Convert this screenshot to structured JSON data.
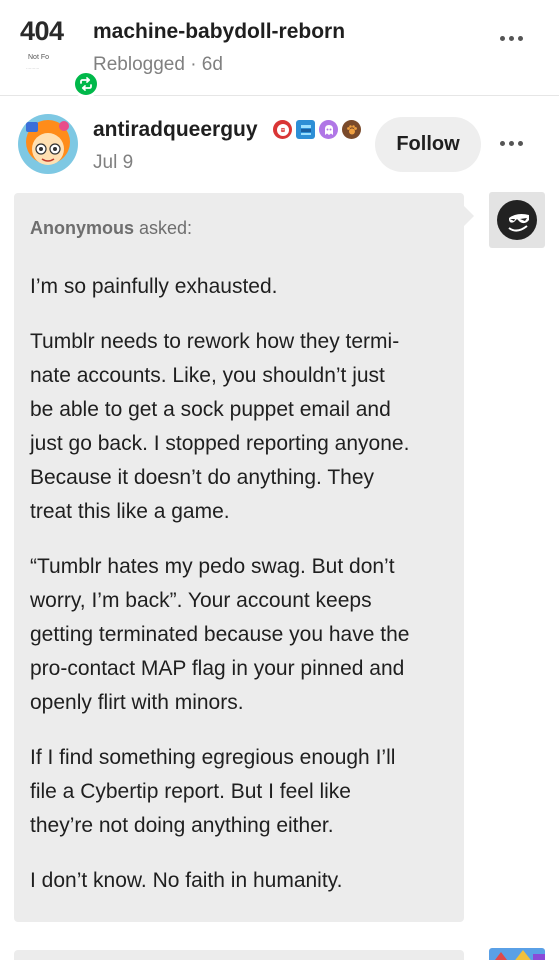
{
  "reblog": {
    "avatar_big": "404",
    "avatar_small": "Not Fo",
    "avatar_tiny": "··········",
    "blog_name": "machine-babydoll-reborn",
    "meta": "Reblogged · 6d"
  },
  "post": {
    "blog_name": "antiradqueerguy",
    "date": "Jul 9",
    "follow_label": "Follow",
    "badges": [
      "red-shield-badge",
      "stacked-blue-badge",
      "purple-ghost-badge",
      "brown-paw-badge"
    ]
  },
  "ask": {
    "asker_name": "Anonymous",
    "asked_label": " asked:",
    "p1": "I’m so painfully exhausted.",
    "p2": "Tumblr needs to rework how they termi-nate accounts. Like, you shouldn’t just be able to get a sock puppet email and just go back. I stopped reporting anyone. Because it doesn’t do anything. They treat this like a game.",
    "p2_lines": [
      "Tumblr needs to rework how they termi-",
      "nate accounts. Like, you shouldn’t just",
      "be able to get a sock puppet email and",
      "just go back. I stopped reporting anyone.",
      "Because it doesn’t do anything. They",
      "treat this like a game."
    ],
    "p3_lines": [
      "“Tumblr hates my pedo swag. But don’t",
      "worry, I’m back”. Your account keeps",
      "getting terminated because you have the",
      "pro-contact MAP flag in your pinned and",
      "openly flirt with minors."
    ],
    "p4_lines": [
      "If I find something egregious enough I’ll",
      "file a Cybertip report. But I feel like",
      "they’re not doing anything either."
    ],
    "p5": "I don’t know. No faith in humanity."
  },
  "colors": {
    "reblog_green": "#00b84a",
    "ask_background": "#ececec",
    "muted_text": "#808080",
    "follow_button_bg": "#eeeeee"
  }
}
